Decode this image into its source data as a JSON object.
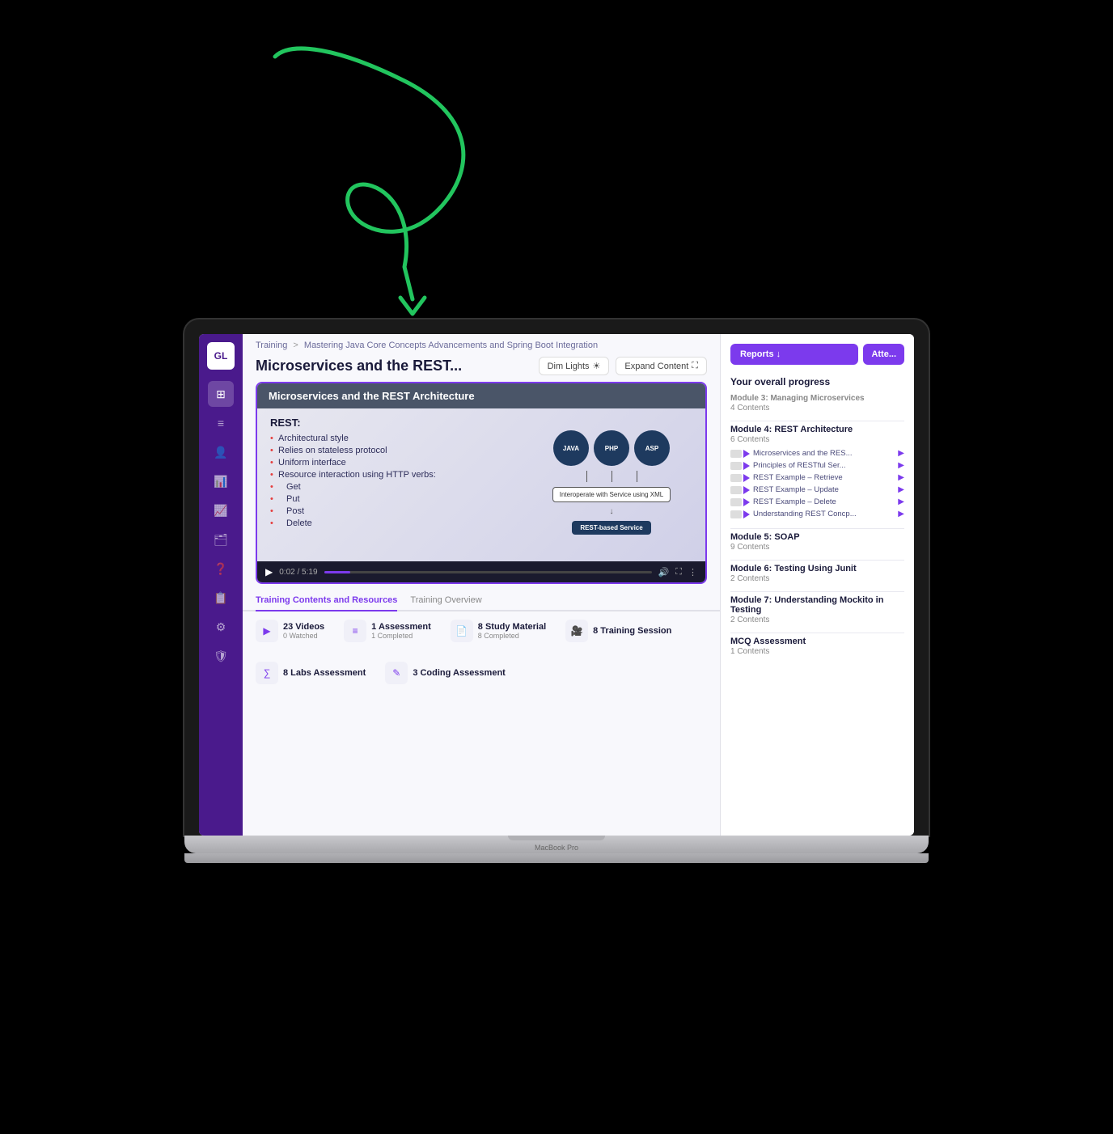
{
  "app": {
    "logo": "GL",
    "macbook_label": "MacBook Pro"
  },
  "breadcrumb": {
    "training": "Training",
    "separator": ">",
    "course": "Mastering Java Core Concepts Advancements and Spring Boot Integration"
  },
  "page": {
    "title": "Microservices and the REST...",
    "dim_lights_label": "Dim Lights",
    "expand_content_label": "Expand Content"
  },
  "slide": {
    "title": "Microservices and the REST Architecture",
    "rest_label": "REST:",
    "bullets": [
      "Architectural style",
      "Relies on stateless protocol",
      "Uniform interface",
      "Resource interaction using HTTP verbs:",
      "Get",
      "Put",
      "Post",
      "Delete"
    ],
    "diagram": {
      "circles": [
        "JAVA",
        "PHP",
        "ASP"
      ],
      "interop_box": "Interoperate with Service using XML",
      "rest_box": "REST-based Service"
    }
  },
  "video_controls": {
    "current_time": "0:02",
    "total_time": "5:19",
    "progress_percent": 8
  },
  "tabs": [
    {
      "label": "Training Contents and Resources",
      "active": true
    },
    {
      "label": "Training Overview",
      "active": false
    }
  ],
  "stats": [
    {
      "icon": "▶",
      "label": "23 Videos",
      "sub": "0 Watched"
    },
    {
      "icon": "≡",
      "label": "1 Assessment",
      "sub": "1 Completed"
    },
    {
      "icon": "📄",
      "label": "8 Study Material",
      "sub": "8 Completed"
    },
    {
      "icon": "🎥",
      "label": "8 Training Session",
      "sub": ""
    },
    {
      "icon": "∑",
      "label": "8 Labs Assessment",
      "sub": ""
    },
    {
      "icon": "✎",
      "label": "3 Coding Assessment",
      "sub": ""
    }
  ],
  "right_panel": {
    "reports_label": "Reports ↓",
    "attendance_label": "Atte...",
    "progress_title": "Your overall progress",
    "modules": [
      {
        "name": "Module 4: REST Architecture",
        "contents_count": "6 Contents",
        "items": [
          "Microservices and the RES...",
          "Principles of RESTful Ser...",
          "REST Example – Retrieve",
          "REST Example – Update",
          "REST Example – Delete",
          "Understanding REST Concp..."
        ]
      },
      {
        "name": "Module 5: SOAP",
        "contents_count": "9 Contents",
        "items": []
      },
      {
        "name": "Module 6: Testing Using Junit",
        "contents_count": "2 Contents",
        "items": []
      },
      {
        "name": "Module 7: Understanding Mockito in Testing",
        "contents_count": "2 Contents",
        "items": []
      },
      {
        "name": "MCQ Assessment",
        "contents_count": "1 Contents",
        "items": []
      }
    ],
    "truncated_module": "Module 3: Managing Microservices",
    "truncated_contents": "4 Contents"
  },
  "sidebar_icons": [
    "⊞",
    "≡",
    "👤",
    "📊",
    "📈",
    "🗂",
    "❓",
    "📋",
    "⚙",
    "🛡"
  ]
}
